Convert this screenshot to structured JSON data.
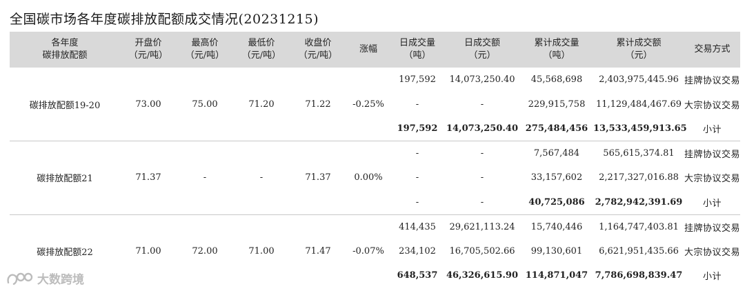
{
  "title": "全国碳市场各年度碳排放配额成交情况(20231215)",
  "headers": {
    "product": [
      "各年度",
      "碳排放配额"
    ],
    "open": [
      "开盘价",
      "（元/吨）"
    ],
    "high": [
      "最高价",
      "（元/吨）"
    ],
    "low": [
      "最低价",
      "（元/吨）"
    ],
    "close": [
      "收盘价",
      "（元/吨）"
    ],
    "change": "涨幅",
    "daily_vol": [
      "日成交量",
      "（吨）"
    ],
    "daily_amt": [
      "日成交额",
      "（元）"
    ],
    "cum_vol": [
      "累计成交量",
      "（吨）"
    ],
    "cum_amt": [
      "累计成交额",
      "（元）"
    ],
    "method": "交易方式"
  },
  "groups": [
    {
      "name": "碳排放配额19-20",
      "open": "73.00",
      "high": "75.00",
      "low": "71.20",
      "close": "71.22",
      "change": "-0.25%",
      "rows": [
        {
          "daily_vol": "197,592",
          "daily_amt": "14,073,250.40",
          "cum_vol": "45,568,698",
          "cum_amt": "2,403,975,445.96",
          "method": "挂牌协议交易"
        },
        {
          "daily_vol": "-",
          "daily_amt": "-",
          "cum_vol": "229,915,758",
          "cum_amt": "11,129,484,467.69",
          "method": "大宗协议交易"
        },
        {
          "daily_vol": "197,592",
          "daily_amt": "14,073,250.40",
          "cum_vol": "275,484,456",
          "cum_amt": "13,533,459,913.65",
          "method": "小计"
        }
      ]
    },
    {
      "name": "碳排放配额21",
      "open": "71.37",
      "high": "-",
      "low": "-",
      "close": "71.37",
      "change": "0.00%",
      "rows": [
        {
          "daily_vol": "-",
          "daily_amt": "-",
          "cum_vol": "7,567,484",
          "cum_amt": "565,615,374.81",
          "method": "挂牌协议交易"
        },
        {
          "daily_vol": "-",
          "daily_amt": "-",
          "cum_vol": "33,157,602",
          "cum_amt": "2,217,327,016.88",
          "method": "大宗协议交易"
        },
        {
          "daily_vol": "-",
          "daily_amt": "-",
          "cum_vol": "40,725,086",
          "cum_amt": "2,782,942,391.69",
          "method": "小计"
        }
      ]
    },
    {
      "name": "碳排放配额22",
      "open": "71.00",
      "high": "72.00",
      "low": "71.00",
      "close": "71.47",
      "change": "-0.07%",
      "rows": [
        {
          "daily_vol": "414,435",
          "daily_amt": "29,621,113.24",
          "cum_vol": "15,740,446",
          "cum_amt": "1,164,747,403.81",
          "method": "挂牌协议交易"
        },
        {
          "daily_vol": "234,102",
          "daily_amt": "16,705,502.66",
          "cum_vol": "99,130,601",
          "cum_amt": "6,621,951,435.66",
          "method": "大宗协议交易"
        },
        {
          "daily_vol": "648,537",
          "daily_amt": "46,326,615.90",
          "cum_vol": "114,871,047",
          "cum_amt": "7,786,698,839.47",
          "method": "小计"
        }
      ]
    }
  ],
  "watermark": "大数跨境"
}
